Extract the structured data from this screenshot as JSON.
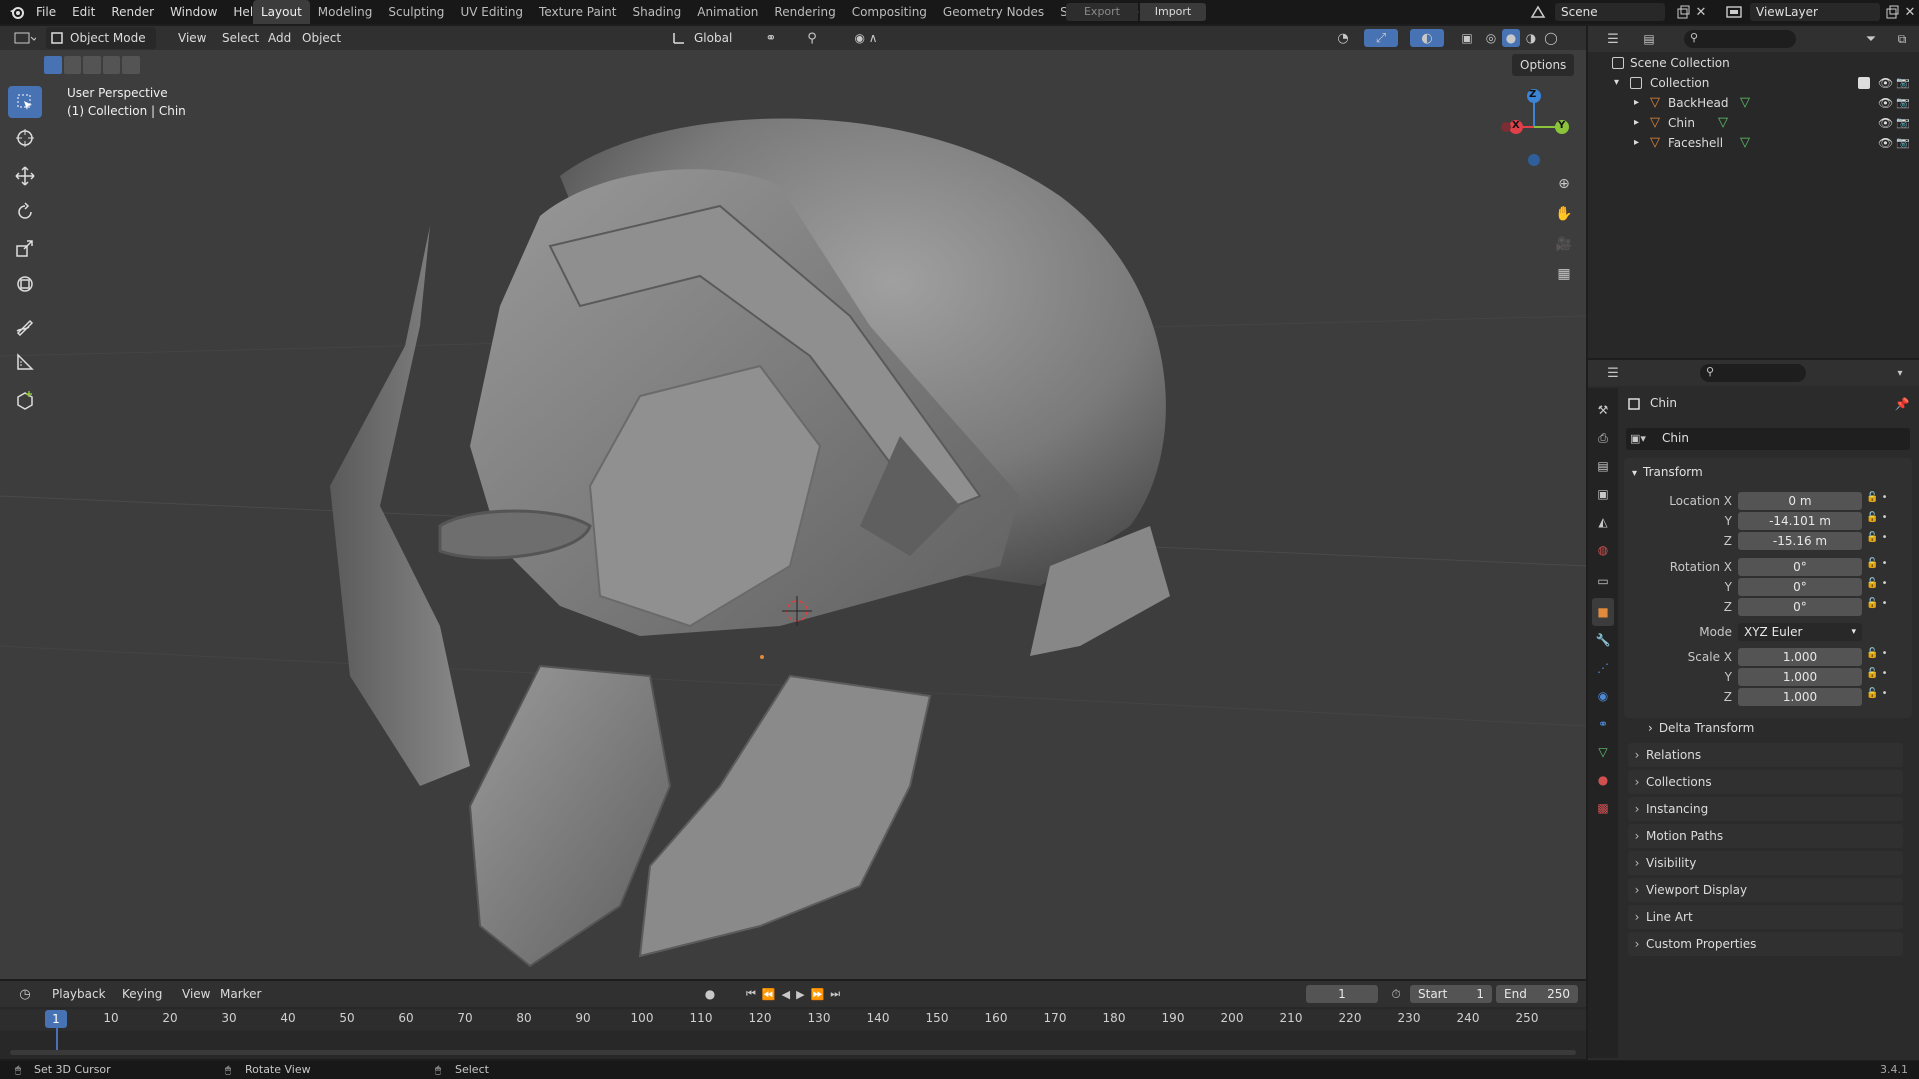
{
  "topbar": {
    "menus": [
      "File",
      "Edit",
      "Render",
      "Window",
      "Help"
    ],
    "workspaces": [
      "Layout",
      "Modeling",
      "Sculpting",
      "UV Editing",
      "Texture Paint",
      "Shading",
      "Animation",
      "Rendering",
      "Compositing",
      "Geometry Nodes",
      "Scripting"
    ],
    "active_workspace": "Layout",
    "add_tab": "+",
    "export_label": "Export",
    "import_label": "Import",
    "scene_name": "Scene",
    "view_layer": "ViewLayer"
  },
  "viewport_header": {
    "mode": "Object Mode",
    "menus": [
      "View",
      "Select",
      "Add",
      "Object"
    ],
    "orientation": "Global",
    "options_label": "Options"
  },
  "viewport": {
    "perspective_label": "User Perspective",
    "collection_label": "(1) Collection | Chin",
    "gizmo_axes": {
      "x": "X",
      "y": "Y",
      "z": "Z"
    }
  },
  "outliner": {
    "scene_collection": "Scene Collection",
    "collection": "Collection",
    "objects": [
      "BackHead",
      "Chin",
      "Faceshell"
    ]
  },
  "properties": {
    "object_name": "Chin",
    "datablock_name": "Chin",
    "transform_title": "Transform",
    "location_label": "Location X",
    "rotation_label": "Rotation X",
    "scale_label": "Scale X",
    "axis_y": "Y",
    "axis_z": "Z",
    "location": {
      "x": "0 m",
      "y": "-14.101 m",
      "z": "-15.16 m"
    },
    "rotation": {
      "x": "0°",
      "y": "0°",
      "z": "0°"
    },
    "mode_label": "Mode",
    "mode_value": "XYZ Euler",
    "scale": {
      "x": "1.000",
      "y": "1.000",
      "z": "1.000"
    },
    "delta_transform": "Delta Transform",
    "panels": [
      "Relations",
      "Collections",
      "Instancing",
      "Motion Paths",
      "Visibility",
      "Viewport Display",
      "Line Art",
      "Custom Properties"
    ]
  },
  "timeline": {
    "menus": [
      "Playback",
      "Keying",
      "View",
      "Marker"
    ],
    "current_frame": "1",
    "start_label": "Start",
    "start_value": "1",
    "end_label": "End",
    "end_value": "250",
    "ticks": [
      "10",
      "20",
      "30",
      "40",
      "50",
      "60",
      "70",
      "80",
      "90",
      "100",
      "110",
      "120",
      "130",
      "140",
      "150",
      "160",
      "170",
      "180",
      "190",
      "200",
      "210",
      "220",
      "230",
      "240",
      "250"
    ]
  },
  "statusbar": {
    "hint1": "Set 3D Cursor",
    "hint2": "Rotate View",
    "hint3": "Select",
    "version": "3.4.1"
  },
  "colors": {
    "accent": "#4772b3",
    "x_axis": "#e0404a",
    "y_axis": "#8bc43a",
    "z_axis": "#3b84d6",
    "object_orange": "#e08a3c",
    "mesh_green": "#5fc66b"
  }
}
